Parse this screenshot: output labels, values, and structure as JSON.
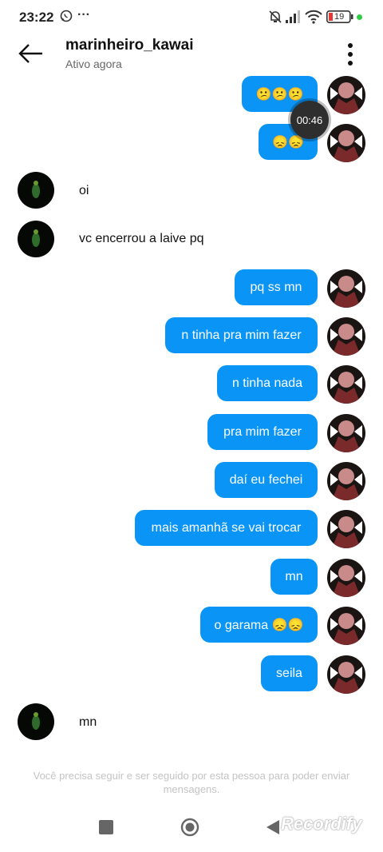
{
  "status_bar": {
    "time": "23:22",
    "more": "···",
    "battery": "19"
  },
  "header": {
    "username": "marinheiro_kawai",
    "status": "Ativo agora"
  },
  "timer": "00:46",
  "messages": [
    {
      "from": "me",
      "text": "😕😕😕"
    },
    {
      "from": "me",
      "text": "😞😞"
    },
    {
      "from": "them",
      "text": "oi"
    },
    {
      "from": "them",
      "text": "vc encerrou a laive pq"
    },
    {
      "from": "me",
      "text": "pq ss mn"
    },
    {
      "from": "me",
      "text": "n tinha pra mim fazer"
    },
    {
      "from": "me",
      "text": "n tinha nada"
    },
    {
      "from": "me",
      "text": "pra mim fazer"
    },
    {
      "from": "me",
      "text": "daí eu fechei"
    },
    {
      "from": "me",
      "text": "mais amanhã se vai trocar"
    },
    {
      "from": "me",
      "text": "mn"
    },
    {
      "from": "me",
      "text": "o garama 😞😞"
    },
    {
      "from": "me",
      "text": "seila"
    },
    {
      "from": "them",
      "text": "mn"
    }
  ],
  "notice": "Você precisa seguir e ser seguido por esta pessoa para poder enviar mensagens.",
  "watermark": "Recordify",
  "colors": {
    "bubble": "#0a95f6",
    "battery_low": "#e53935",
    "online_dot": "#2ecc40"
  }
}
